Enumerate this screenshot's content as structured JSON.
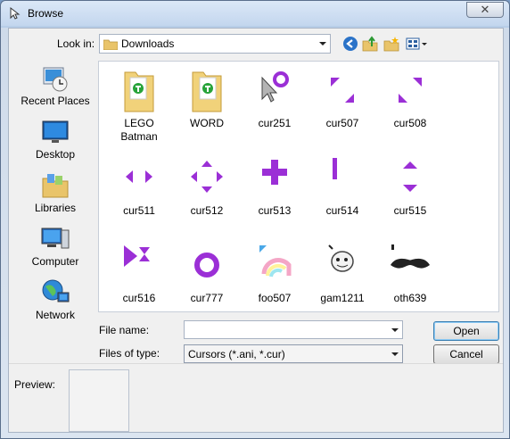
{
  "window": {
    "title": "Browse",
    "close_glyph": "✕"
  },
  "lookin": {
    "label": "Look in:",
    "value": "Downloads"
  },
  "toolbar": {
    "icons": [
      "back-icon",
      "up-folder-icon",
      "new-folder-icon",
      "view-menu-icon"
    ]
  },
  "places": [
    {
      "label": "Recent Places",
      "icon": "recent-places-icon"
    },
    {
      "label": "Desktop",
      "icon": "desktop-icon"
    },
    {
      "label": "Libraries",
      "icon": "libraries-icon"
    },
    {
      "label": "Computer",
      "icon": "computer-icon"
    },
    {
      "label": "Network",
      "icon": "network-icon"
    }
  ],
  "files": [
    {
      "name": "LEGO Batman",
      "kind": "folder"
    },
    {
      "name": "WORD",
      "kind": "folder"
    },
    {
      "name": "cur251",
      "kind": "cursor"
    },
    {
      "name": "cur507",
      "kind": "cursor"
    },
    {
      "name": "cur508",
      "kind": "cursor"
    },
    {
      "name": "cur511",
      "kind": "cursor"
    },
    {
      "name": "cur512",
      "kind": "cursor"
    },
    {
      "name": "cur513",
      "kind": "cursor"
    },
    {
      "name": "cur514",
      "kind": "cursor"
    },
    {
      "name": "cur515",
      "kind": "cursor"
    },
    {
      "name": "cur516",
      "kind": "cursor"
    },
    {
      "name": "cur777",
      "kind": "cursor"
    },
    {
      "name": "foo507",
      "kind": "cursor"
    },
    {
      "name": "gam1211",
      "kind": "cursor"
    },
    {
      "name": "oth639",
      "kind": "cursor"
    }
  ],
  "file_name": {
    "label": "File name:",
    "value": ""
  },
  "files_of_type": {
    "label": "Files of type:",
    "value": "Cursors (*.ani, *.cur)"
  },
  "buttons": {
    "open": "Open",
    "cancel": "Cancel"
  },
  "preview": {
    "label": "Preview:"
  },
  "colors": {
    "cursor_purple": "#9b2fd6",
    "folder_yellow": "#f1d27a"
  }
}
